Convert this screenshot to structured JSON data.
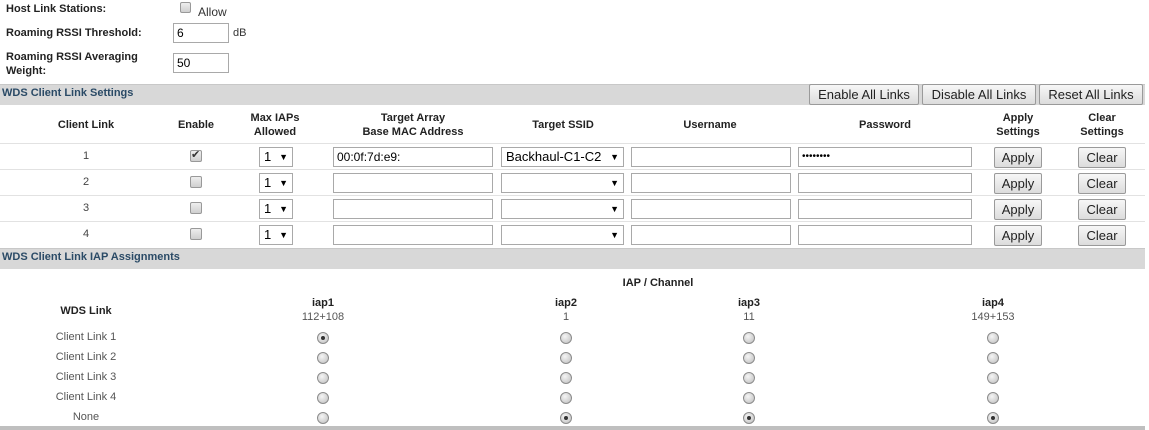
{
  "host_link": {
    "label": "Host Link Stations:",
    "allow_label": "Allow",
    "checked": false
  },
  "rssi_threshold": {
    "label": "Roaming RSSI Threshold:",
    "value": "6",
    "unit": "dB"
  },
  "rssi_weight": {
    "label_line1": "Roaming RSSI Averaging",
    "label_line2": "Weight:",
    "value": "50"
  },
  "wds_client": {
    "title": "WDS Client Link Settings",
    "buttons": {
      "enable_all": "Enable All Links",
      "disable_all": "Disable All Links",
      "reset_all": "Reset All Links"
    },
    "headers": {
      "client_link": "Client Link",
      "enable": "Enable",
      "max_iaps_1": "Max IAPs",
      "max_iaps_2": "Allowed",
      "target_array_1": "Target Array",
      "target_array_2": "Base MAC Address",
      "target_ssid": "Target SSID",
      "username": "Username",
      "password": "Password",
      "apply_1": "Apply",
      "apply_2": "Settings",
      "clear_1": "Clear",
      "clear_2": "Settings"
    },
    "rows": [
      {
        "num": "1",
        "enabled": true,
        "max_iaps": "1",
        "mac": "00:0f:7d:e9:",
        "ssid": "Backhaul-C1-C2",
        "username": "",
        "password": "••••••••",
        "apply": "Apply",
        "clear": "Clear"
      },
      {
        "num": "2",
        "enabled": false,
        "max_iaps": "1",
        "mac": "",
        "ssid": "",
        "username": "",
        "password": "",
        "apply": "Apply",
        "clear": "Clear"
      },
      {
        "num": "3",
        "enabled": false,
        "max_iaps": "1",
        "mac": "",
        "ssid": "",
        "username": "",
        "password": "",
        "apply": "Apply",
        "clear": "Clear"
      },
      {
        "num": "4",
        "enabled": false,
        "max_iaps": "1",
        "mac": "",
        "ssid": "",
        "username": "",
        "password": "",
        "apply": "Apply",
        "clear": "Clear"
      }
    ]
  },
  "iap_assign": {
    "title": "WDS Client Link IAP Assignments",
    "group_header": "IAP / Channel",
    "link_header": "WDS Link",
    "iaps": [
      {
        "name": "iap1",
        "channel": "112+108"
      },
      {
        "name": "iap2",
        "channel": "1"
      },
      {
        "name": "iap3",
        "channel": "11"
      },
      {
        "name": "iap4",
        "channel": "149+153"
      }
    ],
    "links": [
      {
        "label": "Client Link 1",
        "selected": [
          true,
          false,
          false,
          false
        ]
      },
      {
        "label": "Client Link 2",
        "selected": [
          false,
          false,
          false,
          false
        ]
      },
      {
        "label": "Client Link 3",
        "selected": [
          false,
          false,
          false,
          false
        ]
      },
      {
        "label": "Client Link 4",
        "selected": [
          false,
          false,
          false,
          false
        ]
      },
      {
        "label": "None",
        "selected": [
          false,
          true,
          true,
          true
        ]
      }
    ]
  }
}
